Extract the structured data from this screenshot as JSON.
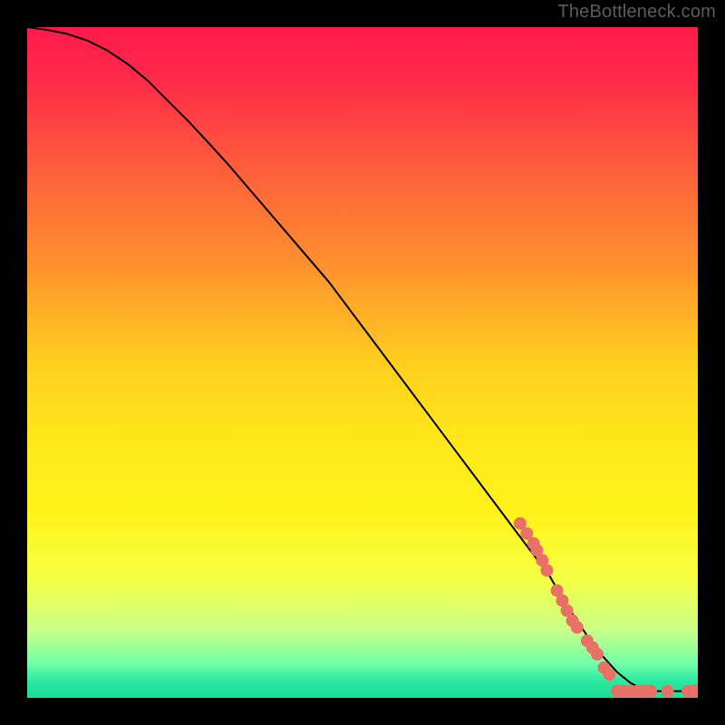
{
  "attribution": "TheBottleneck.com",
  "chart_data": {
    "type": "line",
    "title": "",
    "xlabel": "",
    "ylabel": "",
    "xlim": [
      0,
      100
    ],
    "ylim": [
      0,
      100
    ],
    "background_gradient": {
      "stops": [
        {
          "offset": 0.0,
          "color": "#ff1a4b"
        },
        {
          "offset": 0.08,
          "color": "#ff2a48"
        },
        {
          "offset": 0.2,
          "color": "#ff5a3c"
        },
        {
          "offset": 0.35,
          "color": "#ff8f2e"
        },
        {
          "offset": 0.5,
          "color": "#ffce1e"
        },
        {
          "offset": 0.62,
          "color": "#ffe81a"
        },
        {
          "offset": 0.72,
          "color": "#fff21a"
        },
        {
          "offset": 0.82,
          "color": "#f6ff42"
        },
        {
          "offset": 0.9,
          "color": "#c8ff88"
        },
        {
          "offset": 0.95,
          "color": "#6effa8"
        },
        {
          "offset": 0.975,
          "color": "#2be8a0"
        },
        {
          "offset": 1.0,
          "color": "#1adf95"
        }
      ]
    },
    "series": [
      {
        "name": "bottleneck-curve",
        "color": "#000000",
        "stroke_width": 2,
        "x": [
          0,
          3,
          6,
          9,
          12,
          15,
          18,
          21,
          24,
          27,
          30,
          33,
          36,
          39,
          42,
          45,
          48,
          51,
          54,
          57,
          60,
          63,
          66,
          69,
          72,
          75,
          78,
          80,
          82,
          84,
          86,
          88,
          90,
          92,
          94,
          96,
          98,
          100
        ],
        "y": [
          100,
          99.6,
          99.0,
          98.0,
          96.5,
          94.5,
          92.0,
          89.0,
          86.0,
          82.8,
          79.5,
          76.0,
          72.5,
          69.0,
          65.5,
          62.0,
          58.0,
          54.0,
          50.0,
          46.0,
          42.0,
          38.0,
          34.0,
          30.0,
          26.0,
          22.0,
          18.0,
          14.5,
          11.5,
          8.5,
          6.0,
          3.8,
          2.2,
          1.2,
          1.0,
          1.0,
          1.0,
          1.0
        ]
      }
    ],
    "scatter": [
      {
        "name": "data-points",
        "color": "#e87066",
        "radius": 7,
        "points": [
          {
            "x": 73.5,
            "y": 26.0
          },
          {
            "x": 74.5,
            "y": 24.5
          },
          {
            "x": 75.5,
            "y": 23.0
          },
          {
            "x": 76.0,
            "y": 22.0
          },
          {
            "x": 76.8,
            "y": 20.5
          },
          {
            "x": 77.5,
            "y": 19.0
          },
          {
            "x": 79.0,
            "y": 16.0
          },
          {
            "x": 79.8,
            "y": 14.5
          },
          {
            "x": 80.5,
            "y": 13.0
          },
          {
            "x": 81.3,
            "y": 11.5
          },
          {
            "x": 82.0,
            "y": 10.5
          },
          {
            "x": 83.5,
            "y": 8.5
          },
          {
            "x": 84.3,
            "y": 7.5
          },
          {
            "x": 85.0,
            "y": 6.5
          },
          {
            "x": 86.0,
            "y": 4.5
          },
          {
            "x": 86.8,
            "y": 3.5
          },
          {
            "x": 88.0,
            "y": 1.0
          },
          {
            "x": 89.0,
            "y": 1.0
          },
          {
            "x": 90.0,
            "y": 1.0
          },
          {
            "x": 91.0,
            "y": 1.0
          },
          {
            "x": 92.0,
            "y": 1.0
          },
          {
            "x": 93.0,
            "y": 1.0
          },
          {
            "x": 95.5,
            "y": 1.0
          },
          {
            "x": 98.5,
            "y": 1.0
          },
          {
            "x": 99.5,
            "y": 1.0
          }
        ]
      }
    ]
  }
}
